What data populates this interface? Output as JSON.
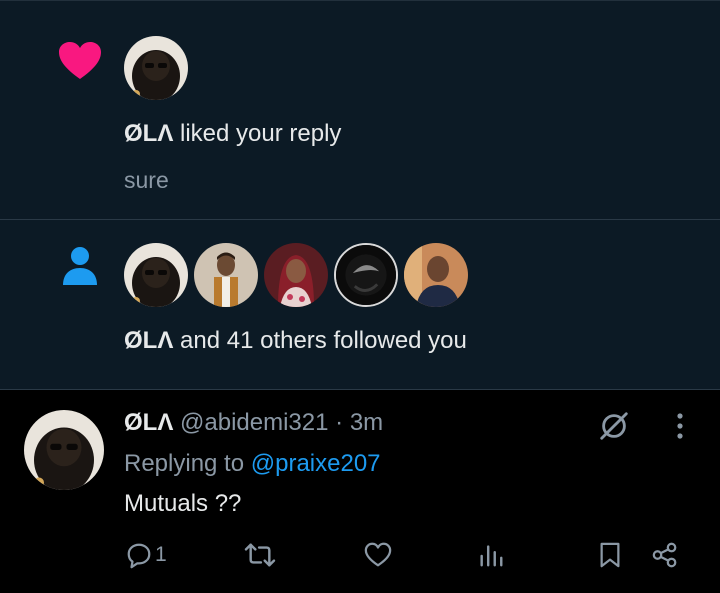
{
  "like_notification": {
    "actor": "ØLΛ",
    "action": "liked your reply",
    "snippet": "sure",
    "icon": "heart-icon",
    "icon_color": "#f91880"
  },
  "follow_notification": {
    "actor": "ØLΛ",
    "action": "and 41 others followed you",
    "icon": "person-icon",
    "icon_color": "#1d9bf0"
  },
  "tweet": {
    "display_name": "ØLΛ",
    "handle": "@abidemi321",
    "separator": "·",
    "time": "3m",
    "replying_to_label": "Replying to",
    "replying_to_handle": "@praixe207",
    "text": "Mutuals ??",
    "reply_count": "1",
    "actions": [
      "reply-icon",
      "retweet-icon",
      "like-icon",
      "views-icon",
      "bookmark-icon",
      "share-icon"
    ]
  },
  "colors": {
    "notification_bg": "#0c1a25",
    "tweet_bg": "#000000",
    "muted_text": "#8b98a5",
    "link": "#1d9bf0"
  }
}
